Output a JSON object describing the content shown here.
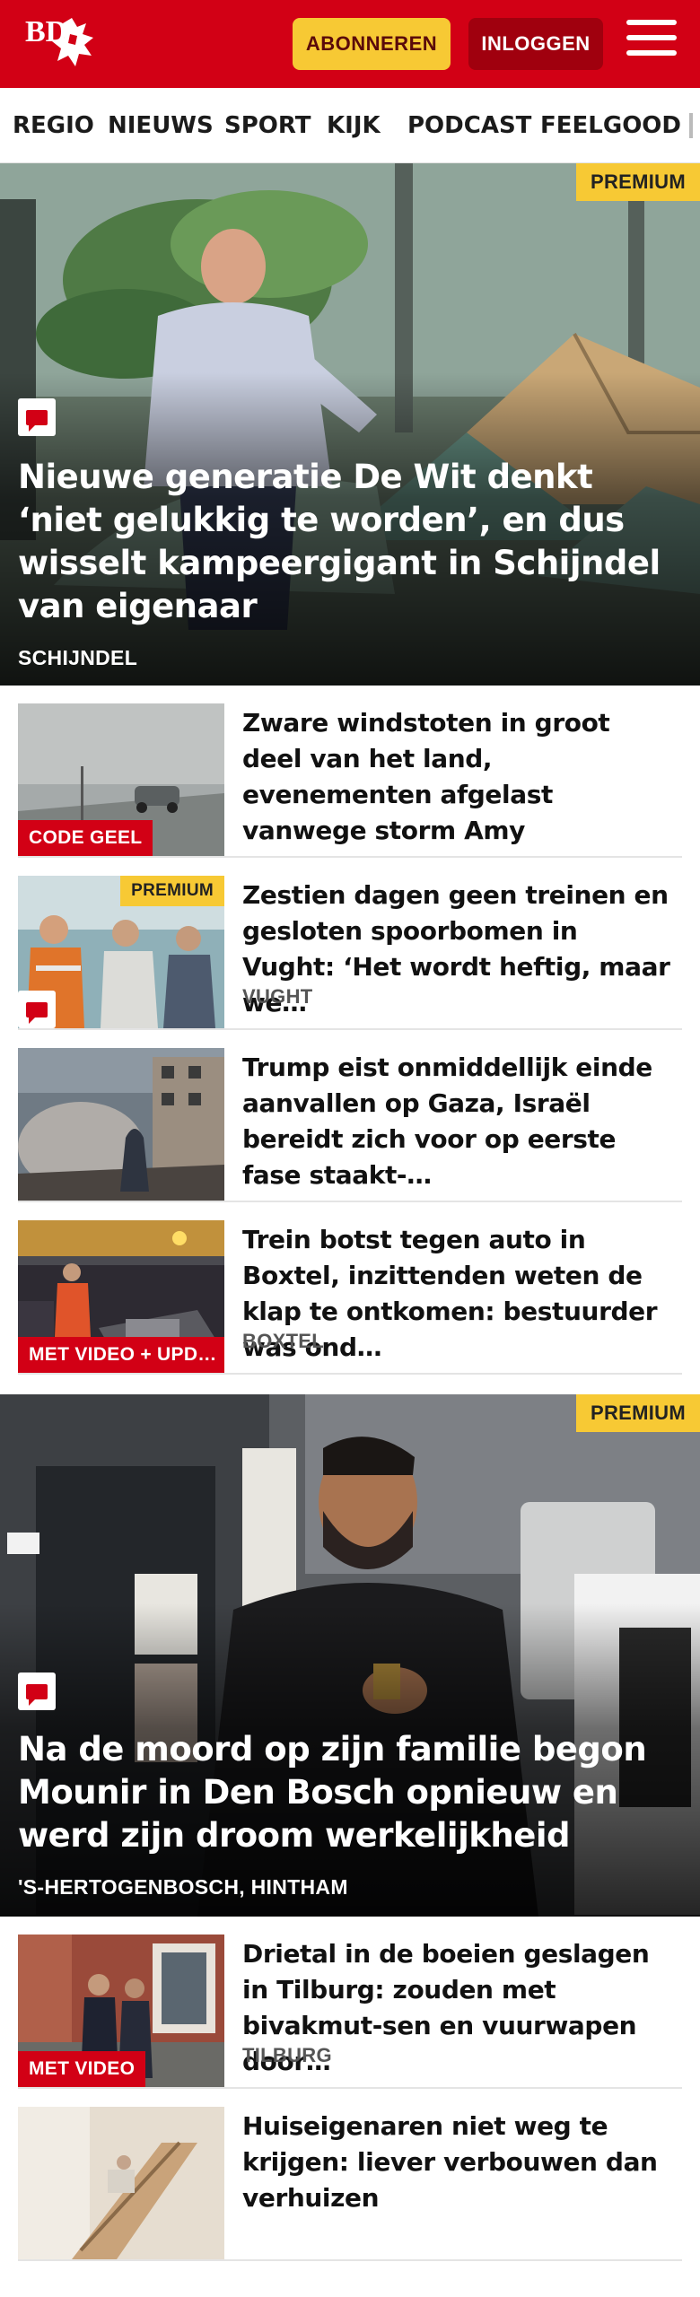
{
  "header": {
    "logo_text": "BD",
    "subscribe_label": "ABONNEREN",
    "login_label": "INLOGGEN"
  },
  "nav": {
    "items": [
      "REGIO",
      "NIEUWS",
      "SPORT",
      "KIJK",
      "PODCAST",
      "FEELGOOD"
    ]
  },
  "colors": {
    "brand_red": "#d20015",
    "premium_yellow": "#f7c934",
    "login_dark_red": "#a0000e"
  },
  "hero1": {
    "premium": "PREMIUM",
    "title": "Nieuwe generatie De Wit denkt ‘niet gelukkig te worden’, en dus wisselt kampeergigant in Schijndel van eigenaar",
    "location": "SCHIJNDEL",
    "has_comments": true
  },
  "articles1": [
    {
      "title": "Zware windstoten in groot deel van het land, evenementen afgelast vanwege storm Amy",
      "tag": "CODE GEEL"
    },
    {
      "title": "Zestien dagen geen treinen en gesloten spoorbomen in Vught: ‘Het wordt heftig, maar we…",
      "location": "VUGHT",
      "premium": "PREMIUM",
      "has_comments": true
    },
    {
      "title": "Trump eist onmiddellijk einde aanvallen op Gaza, Israël bereidt zich voor op eerste fase staakt-…"
    },
    {
      "title": "Trein botst tegen auto in Boxtel, inzittenden weten de klap te ontkomen: bestuurder was ond…",
      "location": "BOXTEL",
      "tag": "MET VIDEO + UPD…"
    }
  ],
  "hero2": {
    "premium": "PREMIUM",
    "title": "Na de moord op zijn familie begon Mounir in Den Bosch opnieuw en werd zijn droom werkelijkheid",
    "location": "'S-HERTOGENBOSCH, HINTHAM",
    "has_comments": true
  },
  "articles2": [
    {
      "title": "Drietal in de boeien geslagen in Tilburg: zouden met bivakmut-sen en vuurwapen door…",
      "location": "TILBURG",
      "tag": "MET VIDEO"
    },
    {
      "title": "Huiseigenaren niet weg te krijgen: liever verbouwen dan verhuizen"
    }
  ]
}
